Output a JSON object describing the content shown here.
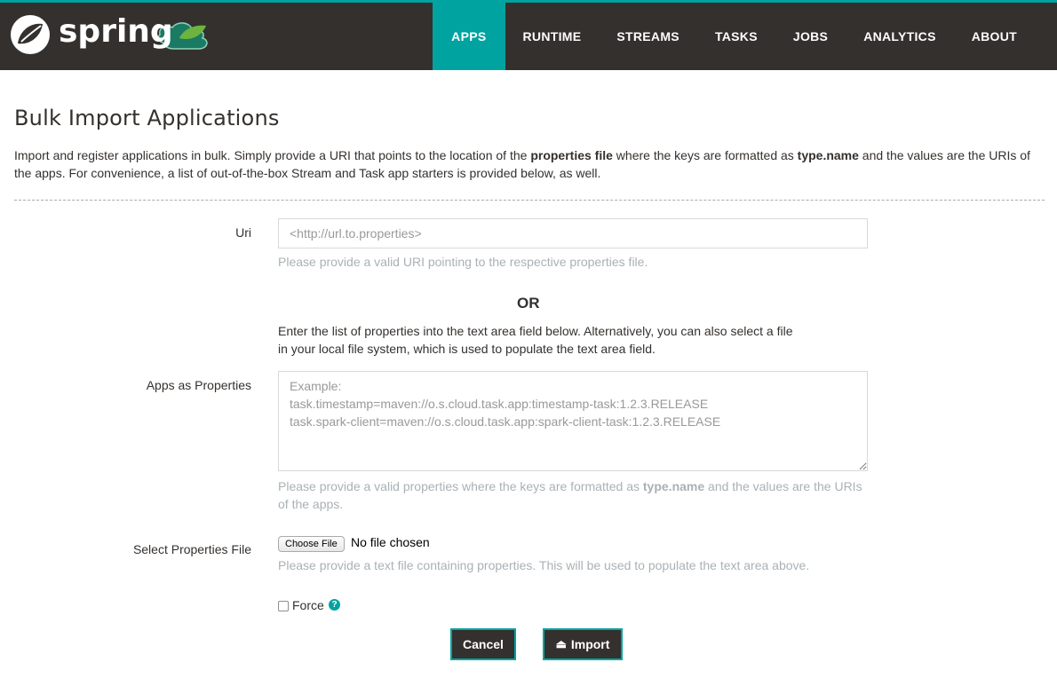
{
  "header": {
    "brand": "spring",
    "nav": [
      {
        "label": "APPS",
        "active": true
      },
      {
        "label": "RUNTIME",
        "active": false
      },
      {
        "label": "STREAMS",
        "active": false
      },
      {
        "label": "TASKS",
        "active": false
      },
      {
        "label": "JOBS",
        "active": false
      },
      {
        "label": "ANALYTICS",
        "active": false
      },
      {
        "label": "ABOUT",
        "active": false
      }
    ]
  },
  "page": {
    "title": "Bulk Import Applications",
    "intro_1": "Import and register applications in bulk. Simply provide a URI that points to the location of the ",
    "intro_bold_1": "properties file",
    "intro_2": " where the keys are formatted as ",
    "intro_bold_2": "type.name",
    "intro_3": " and the values are the URIs of the apps. For convenience, a list of out-of-the-box Stream and Task app starters is provided below, as well."
  },
  "form": {
    "uri_label": "Uri",
    "uri_placeholder": "<http://url.to.properties>",
    "uri_help": "Please provide a valid URI pointing to the respective properties file.",
    "or_text": "OR",
    "properties_desc": "Enter the list of properties into the text area field below. Alternatively, you can also select a file in your local file system, which is used to populate the text area field.",
    "apps_label": "Apps as Properties",
    "apps_placeholder": "Example:\ntask.timestamp=maven://o.s.cloud.task.app:timestamp-task:1.2.3.RELEASE\ntask.spark-client=maven://o.s.cloud.task.app:spark-client-task:1.2.3.RELEASE",
    "apps_help_1": "Please provide a valid properties where the keys are formatted as ",
    "apps_help_bold": "type.name",
    "apps_help_2": " and the values are the URIs of the apps.",
    "file_label": "Select Properties File",
    "file_button": "Choose File",
    "file_status": "No file chosen",
    "file_help": "Please provide a text file containing properties. This will be used to populate the text area above.",
    "force_label": "Force",
    "force_checked": false,
    "cancel_label": "Cancel",
    "import_label": "Import"
  },
  "colors": {
    "accent": "#00a3a0",
    "header_bg": "#34302d"
  }
}
